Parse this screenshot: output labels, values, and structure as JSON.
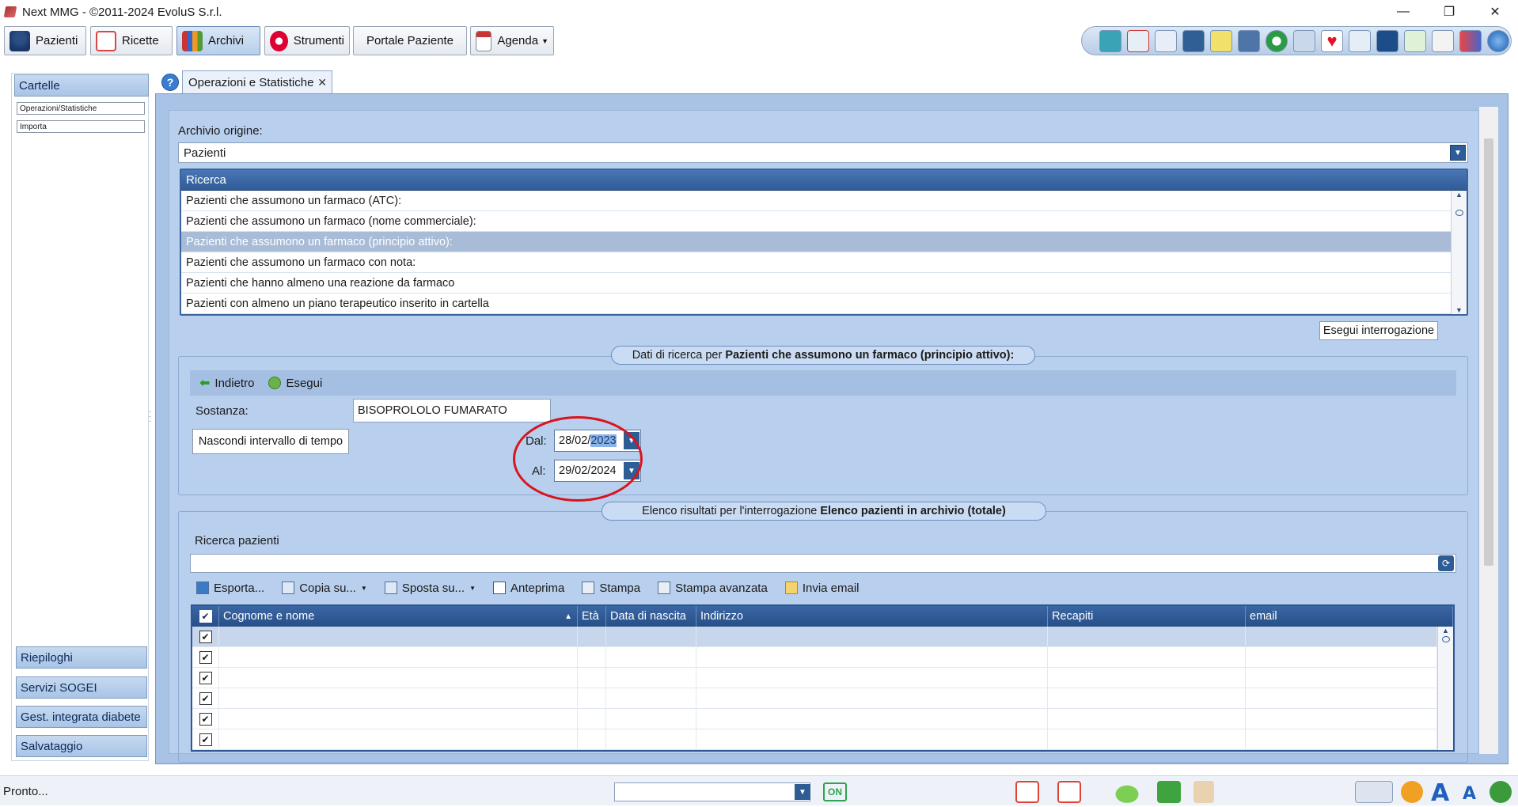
{
  "window": {
    "title": "Next MMG - ©2011-2024 EvoluS S.r.l.",
    "minimize": "—",
    "restore": "❐",
    "close": "✕"
  },
  "toolbar": {
    "pazienti": "Pazienti",
    "ricette": "Ricette",
    "archivi": "Archivi",
    "strumenti": "Strumenti",
    "portale": "Portale Paziente",
    "agenda": "Agenda"
  },
  "quick_icons": [
    "image-icon",
    "syringe-icon",
    "book-icon",
    "shield-icon",
    "pharmacy-icon",
    "monitor-icon",
    "plus-icon",
    "card-icon",
    "heart-icon",
    "chart-icon",
    "body-icon",
    "document-icon",
    "list-icon",
    "tools-icon",
    "globe-icon"
  ],
  "sidebar": {
    "cartelle": "Cartelle",
    "items": [
      "Operazioni/Statistiche",
      "Importa"
    ],
    "riepiloghi": "Riepiloghi",
    "servizi": "Servizi SOGEI",
    "diabete": "Gest. integrata diabete",
    "salvataggio": "Salvataggio"
  },
  "tab": {
    "help": "?",
    "label": "Operazioni e Statistiche",
    "close": "✕"
  },
  "archivio": {
    "label": "Archivio origine:",
    "value": "Pazienti"
  },
  "ricerca": {
    "header": "Ricerca",
    "rows": [
      "Pazienti che assumono un farmaco (ATC):",
      "Pazienti che assumono un farmaco (nome commerciale):",
      "Pazienti che assumono un farmaco (principio attivo):",
      "Pazienti che assumono un farmaco con nota:",
      "Pazienti che hanno almeno una reazione da farmaco",
      "Pazienti con almeno un piano terapeutico inserito in cartella"
    ],
    "selected_index": 2
  },
  "esegui_interrogazione": "Esegui interrogazione",
  "dati": {
    "prefix": "Dati di ricerca per",
    "bold": "Pazienti che assumono un farmaco (principio attivo):",
    "indietro": "Indietro",
    "esegui": "Esegui",
    "sostanza_label": "Sostanza:",
    "sostanza_value": "BISOPROLOLO FUMARATO",
    "nascondi": "Nascondi intervallo di tempo",
    "dal_label": "Dal:",
    "dal_day": "28/02/",
    "dal_year": "2023",
    "al_label": "Al:",
    "al_value": "29/02/2024"
  },
  "elenco": {
    "prefix": "Elenco risultati per l'interrogazione",
    "bold": "Elenco pazienti in archivio (totale)",
    "ricerca_label": "Ricerca pazienti",
    "actions": {
      "esporta": "Esporta...",
      "copia": "Copia su...",
      "sposta": "Sposta su...",
      "anteprima": "Anteprima",
      "stampa": "Stampa",
      "stampa_avanzata": "Stampa avanzata",
      "invia_email": "Invia email"
    },
    "columns": [
      "Cognome e nome",
      "Età",
      "Data di nascita",
      "Indirizzo",
      "Recapiti",
      "email"
    ],
    "row_count": 6
  },
  "status": {
    "text": "Pronto...",
    "on": "ON"
  }
}
